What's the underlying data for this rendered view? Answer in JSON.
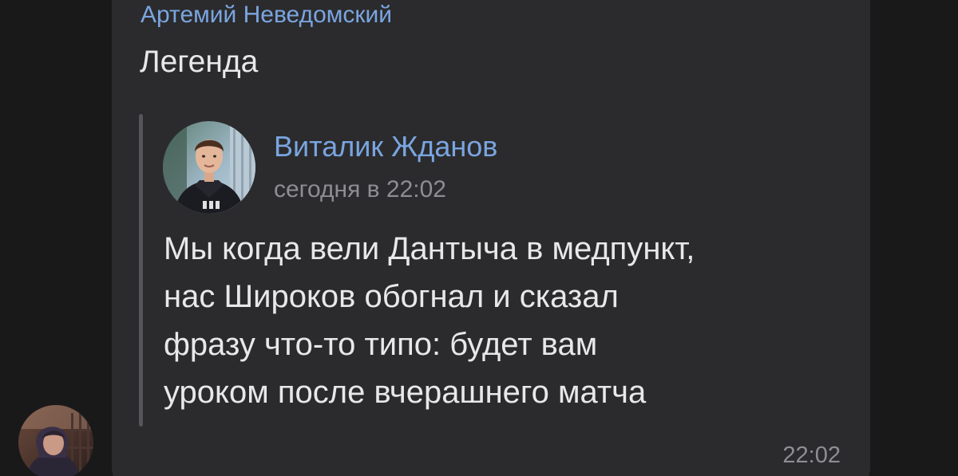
{
  "message": {
    "sender_name": "Артемий Неведомский",
    "text": "Легенда",
    "time": "22:02"
  },
  "quoted_post": {
    "author_name": "Виталик Жданов",
    "date": "сегодня в 22:02",
    "body_lines": [
      "Мы когда вели Дантыча в медпункт,",
      "нас Широков обогнал и сказал",
      "фразу что-то типо: будет вам",
      "уроком после вчерашнего матча"
    ]
  },
  "colors": {
    "background": "#19191a",
    "bubble": "#2b2b2d",
    "name_accent": "#7aa5e0",
    "text": "#e8e8ea",
    "muted": "#8d8e93",
    "quote_bar": "#55565a"
  }
}
